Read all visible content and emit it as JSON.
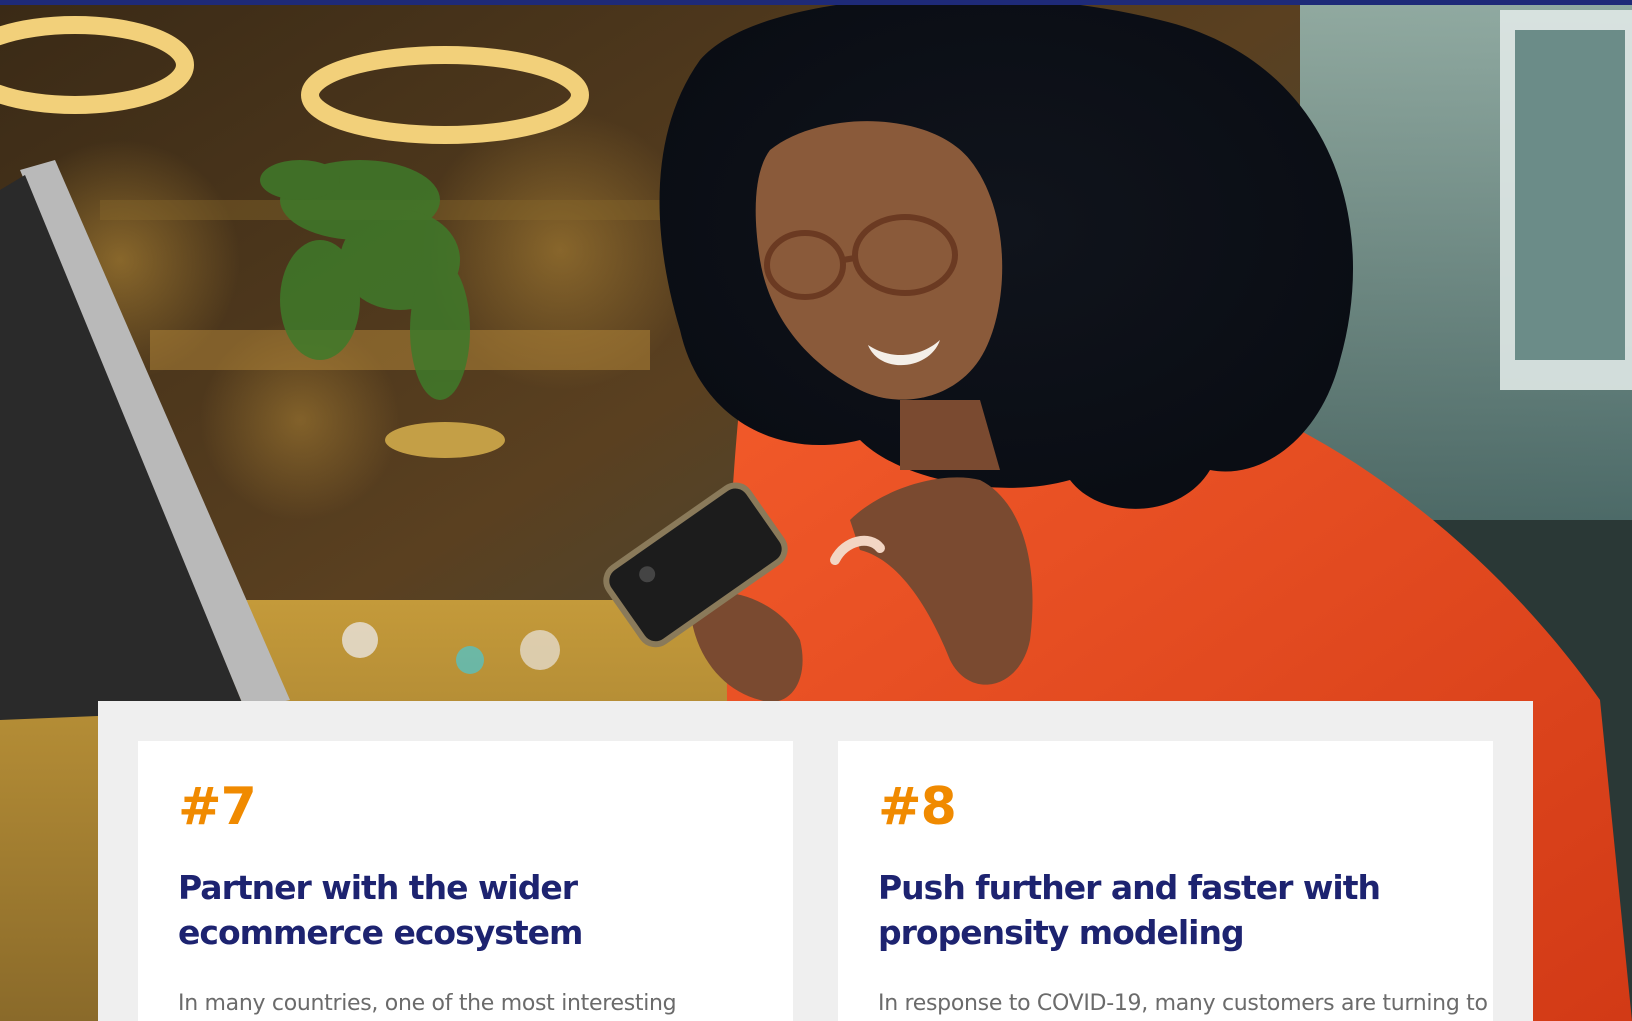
{
  "cards": [
    {
      "number": "#7",
      "title": "Partner with the wider ecommerce ecosystem",
      "body": "In many countries, one of the most interesting"
    },
    {
      "number": "#8",
      "title": "Push further and faster with propensity modeling",
      "body": "In response to COVID-19, many customers are turning to"
    }
  ],
  "colors": {
    "number": "#f08a00",
    "title": "#1d2370",
    "body": "#6b6b6b",
    "top_bar": "#1e2a78"
  }
}
